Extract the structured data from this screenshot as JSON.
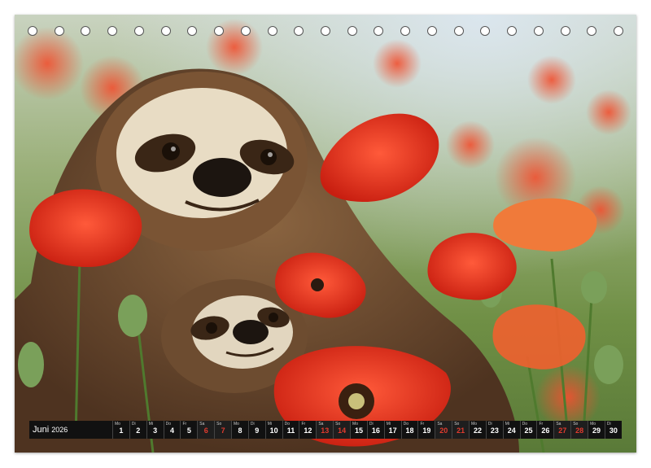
{
  "calendar": {
    "month": "Juni",
    "year": "2026",
    "days": [
      {
        "wd": "Mo",
        "n": "1",
        "we": false
      },
      {
        "wd": "Di",
        "n": "2",
        "we": false
      },
      {
        "wd": "Mi",
        "n": "3",
        "we": false
      },
      {
        "wd": "Do",
        "n": "4",
        "we": false
      },
      {
        "wd": "Fr",
        "n": "5",
        "we": false
      },
      {
        "wd": "Sa",
        "n": "6",
        "we": true
      },
      {
        "wd": "So",
        "n": "7",
        "we": true
      },
      {
        "wd": "Mo",
        "n": "8",
        "we": false
      },
      {
        "wd": "Di",
        "n": "9",
        "we": false
      },
      {
        "wd": "Mi",
        "n": "10",
        "we": false
      },
      {
        "wd": "Do",
        "n": "11",
        "we": false
      },
      {
        "wd": "Fr",
        "n": "12",
        "we": false
      },
      {
        "wd": "Sa",
        "n": "13",
        "we": true
      },
      {
        "wd": "So",
        "n": "14",
        "we": true
      },
      {
        "wd": "Mo",
        "n": "15",
        "we": false
      },
      {
        "wd": "Di",
        "n": "16",
        "we": false
      },
      {
        "wd": "Mi",
        "n": "17",
        "we": false
      },
      {
        "wd": "Do",
        "n": "18",
        "we": false
      },
      {
        "wd": "Fr",
        "n": "19",
        "we": false
      },
      {
        "wd": "Sa",
        "n": "20",
        "we": true
      },
      {
        "wd": "So",
        "n": "21",
        "we": true
      },
      {
        "wd": "Mo",
        "n": "22",
        "we": false
      },
      {
        "wd": "Di",
        "n": "23",
        "we": false
      },
      {
        "wd": "Mi",
        "n": "24",
        "we": false
      },
      {
        "wd": "Do",
        "n": "25",
        "we": false
      },
      {
        "wd": "Fr",
        "n": "26",
        "we": false
      },
      {
        "wd": "Sa",
        "n": "27",
        "we": true
      },
      {
        "wd": "So",
        "n": "28",
        "we": true
      },
      {
        "wd": "Mo",
        "n": "29",
        "we": false
      },
      {
        "wd": "Di",
        "n": "30",
        "we": false
      }
    ]
  },
  "binding": {
    "ring_count": 23
  },
  "colors": {
    "poppy": "#e8361f",
    "sloth_fur": "#6b4a2e",
    "weekend": "#e03b2e",
    "bar": "#111111"
  }
}
